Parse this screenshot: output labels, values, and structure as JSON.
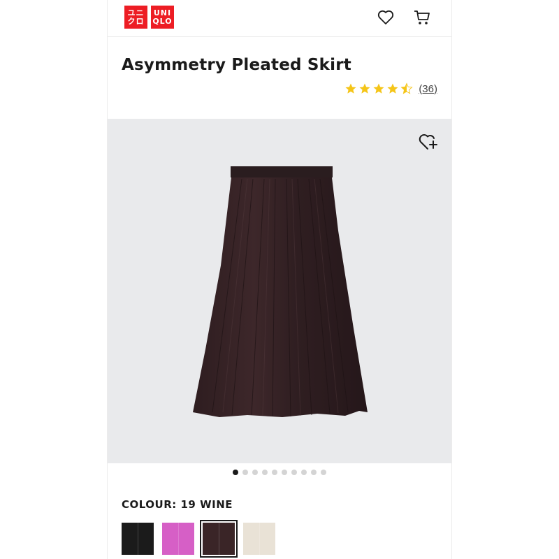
{
  "header": {
    "logo_top": "ユニ\nクロ",
    "logo_bottom": "UNI\nQLO",
    "icons": [
      "heart-icon",
      "cart-icon"
    ]
  },
  "product": {
    "name": "Asymmetry Pleated Skirt",
    "rating": 4.5,
    "review_count": "(36)",
    "image_icon": "wishlist-add-icon"
  },
  "gallery": {
    "total_images": 10,
    "active_index": 0
  },
  "colour": {
    "label": "COLOUR: 19 WINE",
    "swatches": [
      {
        "name": "black",
        "color": "#1b1b1b",
        "selected": false
      },
      {
        "name": "pink",
        "color": "#d65fc6",
        "selected": false
      },
      {
        "name": "wine",
        "color": "#3a2527",
        "selected": true
      },
      {
        "name": "natural",
        "color": "#e9e2d6",
        "selected": false
      }
    ]
  },
  "colors": {
    "brand": "#ed1d24",
    "star": "#f5c518"
  }
}
